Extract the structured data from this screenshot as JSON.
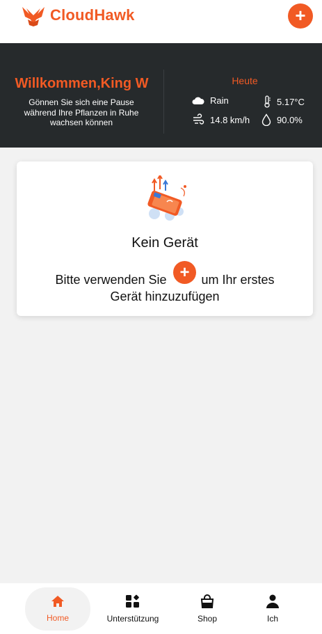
{
  "header": {
    "brand": "CloudHawk",
    "add_label": "+",
    "accent": "#f15a24"
  },
  "banner": {
    "welcome": "Willkommen,King W",
    "subtitle": "Gönnen Sie sich eine Pause während Ihre Pflanzen in Ruhe wachsen können",
    "today": "Heute",
    "weather": {
      "condition": "Rain",
      "temperature": "5.17°C",
      "wind": "14.8 km/h",
      "humidity": "90.0%"
    }
  },
  "card": {
    "title": "Kein Gerät",
    "hint_before": "Bitte verwenden Sie",
    "hint_after": "um Ihr erstes",
    "hint_line2": "Gerät hinzuzufügen",
    "plus": "+"
  },
  "nav": {
    "items": [
      {
        "label": "Home",
        "icon": "home-icon",
        "active": true
      },
      {
        "label": "Unterstützung",
        "icon": "grid-icon",
        "active": false
      },
      {
        "label": "Shop",
        "icon": "shopping-bag-icon",
        "active": false
      },
      {
        "label": "Ich",
        "icon": "person-icon",
        "active": false
      }
    ]
  }
}
